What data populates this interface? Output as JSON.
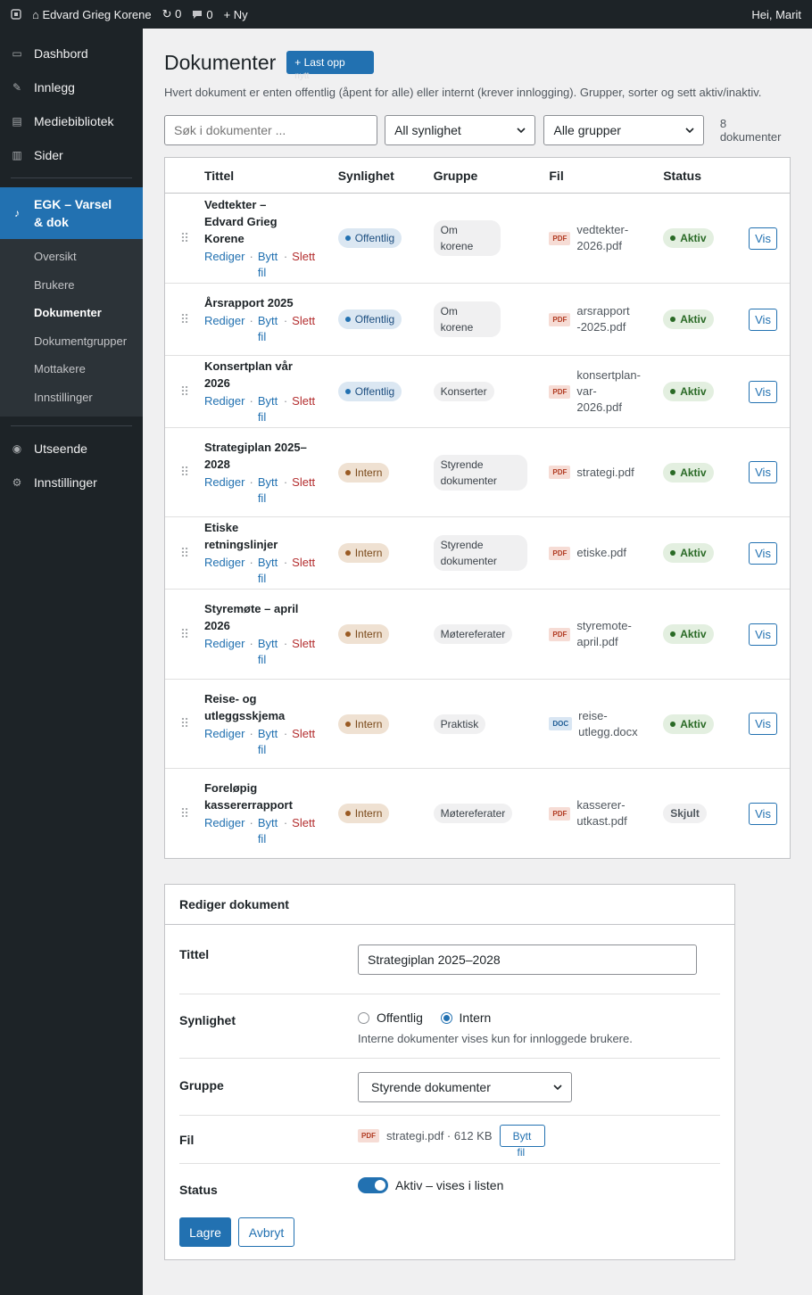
{
  "adminbar": {
    "wp_icon": "wordpress-icon",
    "site": "⌂ Edvard Grieg Korene",
    "updates": "↻ 0",
    "comments": "0",
    "new": "+ Ny",
    "greeting": "Hei, Marit"
  },
  "sidebar": {
    "top_items": [
      {
        "icon": "▭",
        "label": "Dashbord"
      },
      {
        "icon": "✎",
        "label": "Innlegg"
      },
      {
        "icon": "▤",
        "label": "Mediebibliotek"
      },
      {
        "icon": "▥",
        "label": "Sider"
      }
    ],
    "active": {
      "icon": "♪",
      "label": "EGK – Varsel & dok"
    },
    "submenu": [
      "Oversikt",
      "Brukere",
      "Dokumenter",
      "Dokumentgrupper",
      "Mottakere",
      "Innstillinger"
    ],
    "current_sub": "Dokumenter",
    "bottom_items": [
      {
        "icon": "◉",
        "label": "Utseende"
      },
      {
        "icon": "⚙",
        "label": "Innstillinger"
      }
    ]
  },
  "page": {
    "title": "Dokumenter",
    "upload_label": "+ Last opp",
    "upload_overflow": "nytt",
    "description": "Hvert dokument er enten offentlig (åpent for alle) eller internt (krever innlogging). Grupper, sorter og sett aktiv/inaktiv."
  },
  "filters": {
    "search_placeholder": "Søk i dokumenter ...",
    "visibility_selected": "All synlighet",
    "group_selected": "Alle grupper",
    "count": "8 dokumenter"
  },
  "table": {
    "headers": {
      "title": "Tittel",
      "visibility": "Synlighet",
      "group": "Gruppe",
      "file": "Fil",
      "status": "Status"
    },
    "action_labels": {
      "edit": "Rediger",
      "replace": "Bytt fil",
      "delete": "Slett",
      "view": "Vis"
    },
    "rows": [
      {
        "title": "Vedtekter – Edvard Grieg Korene",
        "visibility": "Offentlig",
        "vis_type": "pub",
        "group": "Om korene",
        "file_type": "PDF",
        "file": "vedtekter-2026.pdf",
        "status": "Aktiv",
        "status_type": "active"
      },
      {
        "title": "Årsrapport 2025",
        "visibility": "Offentlig",
        "vis_type": "pub",
        "group": "Om korene",
        "file_type": "PDF",
        "file": "arsrapport-2025.pdf",
        "status": "Aktiv",
        "status_type": "active"
      },
      {
        "title": "Konsertplan vår 2026",
        "visibility": "Offentlig",
        "vis_type": "pub",
        "group": "Konserter",
        "file_type": "PDF",
        "file": "konsertplan-var-2026.pdf",
        "status": "Aktiv",
        "status_type": "active"
      },
      {
        "title": "Strategiplan 2025–2028",
        "visibility": "Intern",
        "vis_type": "int",
        "group": "Styrende dokumenter",
        "file_type": "PDF",
        "file": "strategi.pdf",
        "status": "Aktiv",
        "status_type": "active"
      },
      {
        "title": "Etiske retningslinjer",
        "visibility": "Intern",
        "vis_type": "int",
        "group": "Styrende dokumenter",
        "file_type": "PDF",
        "file": "etiske.pdf",
        "status": "Aktiv",
        "status_type": "active"
      },
      {
        "title": "Styremøte – april 2026",
        "visibility": "Intern",
        "vis_type": "int",
        "group": "Møtereferater",
        "file_type": "PDF",
        "file": "styremote-april.pdf",
        "status": "Aktiv",
        "status_type": "active"
      },
      {
        "title": "Reise- og utleggsskjema",
        "visibility": "Intern",
        "vis_type": "int",
        "group": "Praktisk",
        "file_type": "DOC",
        "file": "reise-utlegg.docx",
        "status": "Aktiv",
        "status_type": "active"
      },
      {
        "title": "Foreløpig kassererrapport",
        "visibility": "Intern",
        "vis_type": "int",
        "group": "Møtereferater",
        "file_type": "PDF",
        "file": "kasserer-utkast.pdf",
        "status": "Skjult",
        "status_type": "hidden"
      }
    ]
  },
  "editor": {
    "heading": "Rediger dokument",
    "title_label": "Tittel",
    "title_value": "Strategiplan 2025–2028",
    "visibility_label": "Synlighet",
    "opt_public": "Offentlig",
    "opt_internal": "Intern",
    "selected_visibility": "Intern",
    "visibility_help": "Interne dokumenter vises kun for innloggede brukere.",
    "group_label": "Gruppe",
    "group_value": "Styrende dokumenter",
    "file_label": "Fil",
    "file_type": "PDF",
    "file_info": "strategi.pdf · 612 KB",
    "replace_label": "Bytt",
    "replace_overflow": "fil",
    "status_label": "Status",
    "status_text": "Aktiv – vises i listen",
    "status_on": true,
    "save_label": "Lagre",
    "cancel_label": "Avbryt"
  }
}
